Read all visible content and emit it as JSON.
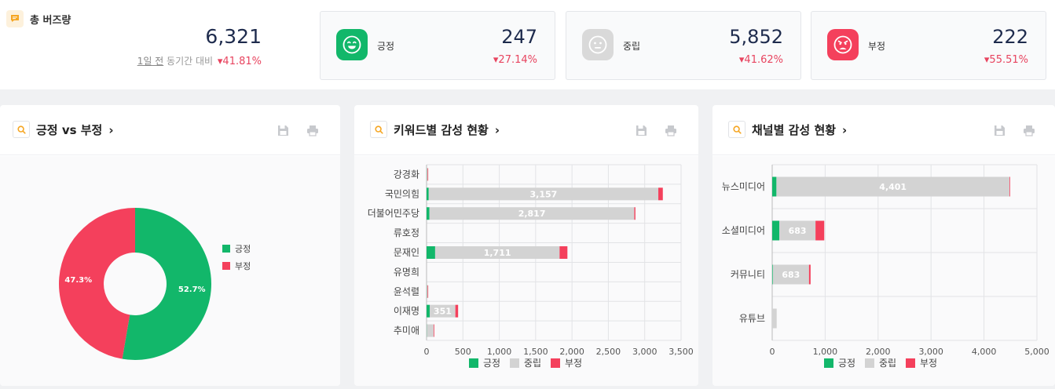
{
  "summary": {
    "title": "총 버즈량",
    "total": "6,321",
    "period_link": "1일 전",
    "compare_text": "동기간 대비",
    "total_change": "41.81%",
    "cards": [
      {
        "label": "긍정",
        "value": "247",
        "change": "27.14%",
        "color": "#12b76a",
        "face": "happy"
      },
      {
        "label": "중립",
        "value": "5,852",
        "change": "41.62%",
        "color": "#d9d9d9",
        "face": "neutral"
      },
      {
        "label": "부정",
        "value": "222",
        "change": "55.51%",
        "color": "#f4405c",
        "face": "angry"
      }
    ]
  },
  "colors": {
    "positive": "#12b76a",
    "neutral": "#d3d3d3",
    "negative": "#f4405c",
    "down": "#e8445f"
  },
  "panels": [
    {
      "title": "긍정 vs 부정",
      "chevron": "›"
    },
    {
      "title": "키워드별 감성 현황",
      "chevron": "›"
    },
    {
      "title": "채널별 감성 현황",
      "chevron": "›"
    }
  ],
  "chart_data": [
    {
      "type": "pie",
      "title": "긍정 vs 부정",
      "slices": [
        {
          "name": "긍정",
          "value": 52.7,
          "label": "52.7%"
        },
        {
          "name": "부정",
          "value": 47.3,
          "label": "47.3%"
        }
      ],
      "legend": [
        "긍정",
        "부정"
      ],
      "legend_position": "right",
      "donut": true
    },
    {
      "type": "bar",
      "orientation": "horizontal",
      "stacked": true,
      "title": "키워드별 감성 현황",
      "categories": [
        "강경화",
        "국민의힘",
        "더불어민주당",
        "류호정",
        "문재인",
        "유명희",
        "윤석렬",
        "이재명",
        "추미애"
      ],
      "series": [
        {
          "name": "긍정",
          "values": [
            2,
            30,
            40,
            0,
            118,
            0,
            2,
            45,
            2
          ]
        },
        {
          "name": "중립",
          "values": [
            12,
            3157,
            2817,
            3,
            1711,
            3,
            12,
            351,
            95
          ]
        },
        {
          "name": "부정",
          "values": [
            2,
            62,
            15,
            0,
            108,
            0,
            1,
            38,
            8
          ]
        }
      ],
      "data_labels": [
        "",
        "3,157",
        "2,817",
        "",
        "1,711",
        "",
        "",
        "351",
        ""
      ],
      "xlim": [
        0,
        3500
      ],
      "xticks": [
        "0",
        "500",
        "1,000",
        "1,500",
        "2,000",
        "2,500",
        "3,000",
        "3,500"
      ],
      "xtick_values": [
        0,
        500,
        1000,
        1500,
        2000,
        2500,
        3000,
        3500
      ],
      "grid": true,
      "legend": [
        "긍정",
        "중립",
        "부정"
      ],
      "legend_position": "bottom"
    },
    {
      "type": "bar",
      "orientation": "horizontal",
      "stacked": true,
      "title": "채널별 감성 현황",
      "categories": [
        "뉴스미디어",
        "소셜미디어",
        "커뮤니티",
        "유튜브"
      ],
      "series": [
        {
          "name": "긍정",
          "values": [
            80,
            135,
            12,
            0
          ]
        },
        {
          "name": "중립",
          "values": [
            4401,
            683,
            683,
            85
          ]
        },
        {
          "name": "부정",
          "values": [
            10,
            165,
            30,
            0
          ]
        }
      ],
      "data_labels": [
        "4,401",
        "683",
        "683",
        ""
      ],
      "xlim": [
        0,
        5000
      ],
      "xticks": [
        "0",
        "1,000",
        "2,000",
        "3,000",
        "4,000",
        "5,000"
      ],
      "xtick_values": [
        0,
        1000,
        2000,
        3000,
        4000,
        5000
      ],
      "grid": true,
      "legend": [
        "긍정",
        "중립",
        "부정"
      ],
      "legend_position": "bottom"
    }
  ]
}
